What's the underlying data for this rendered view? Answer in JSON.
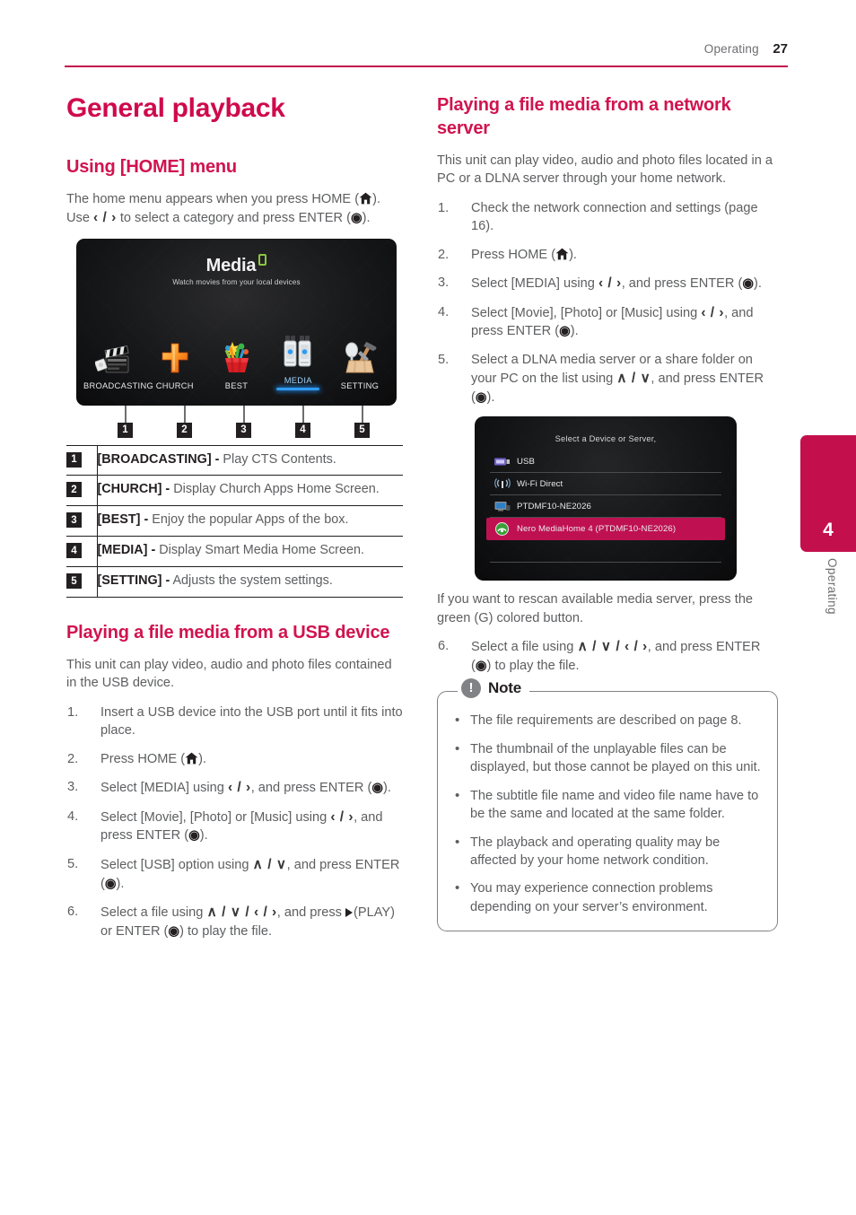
{
  "header": {
    "section": "Operating",
    "page_number": "27"
  },
  "side_tab": {
    "number": "4",
    "label": "Operating",
    "color": "#c3104c"
  },
  "left": {
    "chapter_title": "General playback",
    "home_menu": {
      "heading": "Using [HOME] menu",
      "intro_a": "The home menu appears when you press HOME (",
      "intro_b": "). Use ",
      "nav_lr": "‹ / ›",
      "intro_c": " to select a category and press ENTER (",
      "intro_d": ")."
    },
    "tv_screenshot": {
      "logo": "Media",
      "tagline": "Watch movies from your local devices",
      "items": [
        {
          "label": "BROADCASTING",
          "icon": "clapperboard-icon",
          "active": false
        },
        {
          "label": "CHURCH",
          "icon": "cross-icon",
          "active": false
        },
        {
          "label": "BEST",
          "icon": "popcorn-icon",
          "active": false
        },
        {
          "label": "MEDIA",
          "icon": "usb-sticks-icon",
          "active": true
        },
        {
          "label": "SETTING",
          "icon": "toolbox-icon",
          "active": false
        }
      ]
    },
    "callouts": [
      "1",
      "2",
      "3",
      "4",
      "5"
    ],
    "definitions": [
      {
        "key": "1",
        "term": "[BROADCASTING] -",
        "desc": " Play CTS Contents."
      },
      {
        "key": "2",
        "term": "[CHURCH] -",
        "desc": " Display Church Apps Home Screen."
      },
      {
        "key": "3",
        "term": "[BEST] -",
        "desc": " Enjoy the popular Apps of the box."
      },
      {
        "key": "4",
        "term": "[MEDIA] -",
        "desc": " Display Smart Media Home Screen."
      },
      {
        "key": "5",
        "term": "[SETTING] -",
        "desc": " Adjusts the system settings."
      }
    ],
    "usb": {
      "heading": "Playing a file media from a USB device",
      "intro": "This unit can play video, audio and photo files contained in the USB device.",
      "steps": [
        {
          "num": "1.",
          "parts": [
            {
              "t": "text",
              "v": "Insert a USB device into the USB port until it fits into place."
            }
          ]
        },
        {
          "num": "2.",
          "parts": [
            {
              "t": "text",
              "v": "Press HOME ("
            },
            {
              "t": "home"
            },
            {
              "t": "text",
              "v": ")."
            }
          ]
        },
        {
          "num": "3.",
          "parts": [
            {
              "t": "text",
              "v": "Select [MEDIA] using "
            },
            {
              "t": "nav",
              "v": "‹ / ›"
            },
            {
              "t": "text",
              "v": ", and press ENTER ("
            },
            {
              "t": "enter"
            },
            {
              "t": "text",
              "v": ")."
            }
          ]
        },
        {
          "num": "4.",
          "parts": [
            {
              "t": "text",
              "v": "Select [Movie], [Photo] or [Music] using "
            },
            {
              "t": "nav",
              "v": "‹ / ›"
            },
            {
              "t": "text",
              "v": ", and press ENTER ("
            },
            {
              "t": "enter"
            },
            {
              "t": "text",
              "v": ")."
            }
          ]
        },
        {
          "num": "5.",
          "parts": [
            {
              "t": "text",
              "v": "Select [USB] option using "
            },
            {
              "t": "nav",
              "v": "∧ / ∨"
            },
            {
              "t": "text",
              "v": ", and press ENTER ("
            },
            {
              "t": "enter"
            },
            {
              "t": "text",
              "v": ")."
            }
          ]
        },
        {
          "num": "6.",
          "parts": [
            {
              "t": "text",
              "v": "Select a file using "
            },
            {
              "t": "nav",
              "v": "∧ / ∨ / ‹ / ›"
            },
            {
              "t": "text",
              "v": ", and press "
            },
            {
              "t": "play"
            },
            {
              "t": "text",
              "v": "(PLAY) or ENTER ("
            },
            {
              "t": "enter"
            },
            {
              "t": "text",
              "v": ") to play the file."
            }
          ]
        }
      ]
    }
  },
  "right": {
    "network": {
      "heading": "Playing a file media from a network server",
      "intro": "This unit can play video, audio and photo files located in a PC or a DLNA server through your home network.",
      "steps_top": [
        {
          "num": "1.",
          "parts": [
            {
              "t": "text",
              "v": "Check the network connection and settings (page 16)."
            }
          ]
        },
        {
          "num": "2.",
          "parts": [
            {
              "t": "text",
              "v": "Press HOME ("
            },
            {
              "t": "home"
            },
            {
              "t": "text",
              "v": ")."
            }
          ]
        },
        {
          "num": "3.",
          "parts": [
            {
              "t": "text",
              "v": "Select [MEDIA] using "
            },
            {
              "t": "nav",
              "v": "‹ / ›"
            },
            {
              "t": "text",
              "v": ", and press ENTER ("
            },
            {
              "t": "enter"
            },
            {
              "t": "text",
              "v": ")."
            }
          ]
        },
        {
          "num": "4.",
          "parts": [
            {
              "t": "text",
              "v": "Select [Movie], [Photo] or [Music] using "
            },
            {
              "t": "nav",
              "v": "‹ / ›"
            },
            {
              "t": "text",
              "v": ", and press ENTER ("
            },
            {
              "t": "enter"
            },
            {
              "t": "text",
              "v": ")."
            }
          ]
        },
        {
          "num": "5.",
          "parts": [
            {
              "t": "text",
              "v": "Select a DLNA media server or a share folder on your PC on the list using "
            },
            {
              "t": "nav",
              "v": "∧ / ∨"
            },
            {
              "t": "text",
              "v": ", and press ENTER ("
            },
            {
              "t": "enter"
            },
            {
              "t": "text",
              "v": ")."
            }
          ]
        }
      ],
      "rescan_note": "If you want to rescan available media server, press the green (G) colored button.",
      "steps_bottom": [
        {
          "num": "6.",
          "parts": [
            {
              "t": "text",
              "v": "Select a file using "
            },
            {
              "t": "nav",
              "v": "∧ / ∨ / ‹ / ›"
            },
            {
              "t": "text",
              "v": ", and press ENTER ("
            },
            {
              "t": "enter"
            },
            {
              "t": "text",
              "v": ") to play the file."
            }
          ]
        }
      ]
    },
    "device_screenshot": {
      "title": "Select a Device or Server,",
      "rows": [
        {
          "name": "USB",
          "icon": "usb-plug-icon",
          "selected": false
        },
        {
          "name": "Wi-Fi Direct",
          "icon": "wifi-signal-icon",
          "selected": false
        },
        {
          "name": "PTDMF10-NE2026",
          "icon": "pc-monitor-icon",
          "selected": false
        },
        {
          "name": "Nero MediaHome 4 (PTDMF10-NE2026)",
          "icon": "nero-globe-icon",
          "selected": true
        }
      ],
      "empty_rows": 3,
      "highlight_color": "#bf1152"
    },
    "note": {
      "badge": "!",
      "title": "Note",
      "items": [
        "The file requirements are described on page 8.",
        "The thumbnail of the unplayable files can be displayed, but those cannot be played on this unit.",
        "The subtitle file name and video file name have to be the same and located at the same folder.",
        "The playback and operating quality may be affected by your home network condition.",
        "You may experience connection problems depending on your server’s environment."
      ]
    }
  }
}
